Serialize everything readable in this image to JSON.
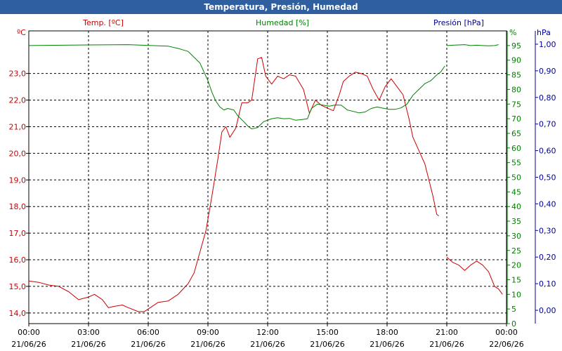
{
  "window": {
    "title": "Temperatura, Presión, Humedad"
  },
  "colors": {
    "temp": "#cc0000",
    "hum": "#008000",
    "pres": "#000099",
    "titlebar": "#2f5f9e"
  },
  "chart_data": {
    "type": "line",
    "title": "Temperatura, Presión, Humedad",
    "grid": true,
    "x_range": [
      "21/06/26 00:00",
      "22/06/26 00:00"
    ],
    "x_ticks": [
      {
        "time": "00:00",
        "date": "21/06/26"
      },
      {
        "time": "03:00",
        "date": "21/06/26"
      },
      {
        "time": "06:00",
        "date": "21/06/26"
      },
      {
        "time": "09:00",
        "date": "21/06/26"
      },
      {
        "time": "12:00",
        "date": "21/06/26"
      },
      {
        "time": "15:00",
        "date": "21/06/26"
      },
      {
        "time": "18:00",
        "date": "21/06/26"
      },
      {
        "time": "21:00",
        "date": "21/06/26"
      },
      {
        "time": "00:00",
        "date": "22/06/26"
      }
    ],
    "axes": {
      "temp": {
        "label": "Temp. [ºC]",
        "unit": "ºC",
        "range": [
          13.6,
          24.6
        ],
        "ticks": [
          "14,0",
          "15,0",
          "16,0",
          "17,0",
          "18,0",
          "19,0",
          "20,0",
          "21,0",
          "22,0",
          "23,0"
        ]
      },
      "hum": {
        "label": "Humedad [%]",
        "unit": "%",
        "range": [
          0,
          100
        ],
        "ticks": [
          "0",
          "5",
          "10",
          "15",
          "20",
          "25",
          "30",
          "35",
          "40",
          "45",
          "50",
          "55",
          "60",
          "65",
          "70",
          "75",
          "80",
          "85",
          "90",
          "95"
        ]
      },
      "pres": {
        "label": "Presión [hPa]",
        "unit": "hPa",
        "range": [
          -0.05,
          1.05
        ],
        "ticks": [
          "0,00",
          "0,10",
          "0,20",
          "0,30",
          "0,40",
          "0,50",
          "0,60",
          "0,70",
          "0,80",
          "0,90",
          "1,00"
        ]
      }
    },
    "series": [
      {
        "name": "Temp. [ºC]",
        "axis": "temp",
        "color": "#cc0000",
        "segments": [
          [
            [
              0,
              15.2
            ],
            [
              0.5,
              15.15
            ],
            [
              1,
              15.05
            ],
            [
              1.5,
              15.0
            ],
            [
              2,
              14.8
            ],
            [
              2.5,
              14.5
            ],
            [
              3,
              14.6
            ],
            [
              3.3,
              14.7
            ],
            [
              3.7,
              14.5
            ],
            [
              4,
              14.2
            ],
            [
              4.3,
              14.25
            ],
            [
              4.7,
              14.3
            ],
            [
              5,
              14.2
            ],
            [
              5.5,
              14.05
            ],
            [
              5.8,
              14.05
            ],
            [
              6.1,
              14.2
            ],
            [
              6.5,
              14.4
            ],
            [
              7,
              14.45
            ],
            [
              7.5,
              14.7
            ],
            [
              8,
              15.1
            ],
            [
              8.3,
              15.5
            ],
            [
              8.6,
              16.3
            ],
            [
              8.9,
              17.1
            ],
            [
              9.2,
              18.4
            ],
            [
              9.5,
              19.8
            ],
            [
              9.7,
              20.8
            ],
            [
              9.9,
              21.0
            ],
            [
              10.1,
              20.6
            ],
            [
              10.4,
              20.95
            ],
            [
              10.7,
              21.9
            ],
            [
              11.0,
              21.9
            ],
            [
              11.2,
              22.0
            ],
            [
              11.5,
              23.55
            ],
            [
              11.7,
              23.6
            ],
            [
              11.9,
              22.9
            ],
            [
              12.2,
              22.6
            ],
            [
              12.5,
              22.9
            ],
            [
              12.8,
              22.8
            ],
            [
              13.1,
              22.95
            ],
            [
              13.4,
              22.9
            ],
            [
              13.8,
              22.4
            ],
            [
              14.1,
              21.5
            ],
            [
              14.4,
              22.0
            ],
            [
              14.7,
              21.8
            ],
            [
              15.0,
              21.7
            ],
            [
              15.3,
              21.6
            ],
            [
              15.6,
              22.2
            ],
            [
              15.8,
              22.7
            ],
            [
              16.1,
              22.9
            ],
            [
              16.4,
              23.05
            ],
            [
              16.7,
              23.0
            ],
            [
              17.0,
              22.9
            ],
            [
              17.3,
              22.4
            ],
            [
              17.6,
              22.0
            ],
            [
              17.9,
              22.5
            ],
            [
              18.2,
              22.8
            ],
            [
              18.5,
              22.5
            ],
            [
              18.8,
              22.2
            ],
            [
              19.1,
              21.3
            ],
            [
              19.3,
              20.6
            ],
            [
              19.6,
              20.1
            ],
            [
              19.9,
              19.6
            ],
            [
              20.1,
              19.0
            ],
            [
              20.3,
              18.4
            ],
            [
              20.5,
              17.7
            ],
            [
              20.6,
              17.65
            ]
          ],
          [
            [
              21.0,
              16.1
            ],
            [
              21.3,
              15.9
            ],
            [
              21.6,
              15.8
            ],
            [
              21.9,
              15.6
            ],
            [
              22.2,
              15.8
            ],
            [
              22.5,
              15.95
            ],
            [
              22.8,
              15.8
            ],
            [
              23.1,
              15.55
            ],
            [
              23.4,
              15.0
            ],
            [
              23.6,
              14.9
            ],
            [
              23.8,
              14.7
            ]
          ]
        ]
      },
      {
        "name": "Humedad [%]",
        "axis": "hum",
        "color": "#008000",
        "segments": [
          [
            [
              0,
              95.0
            ],
            [
              3,
              95.2
            ],
            [
              5,
              95.3
            ],
            [
              7,
              94.8
            ],
            [
              7.5,
              94.0
            ],
            [
              8,
              93.0
            ],
            [
              8.3,
              91.0
            ],
            [
              8.6,
              89.0
            ],
            [
              8.8,
              86.0
            ],
            [
              9.0,
              83.0
            ],
            [
              9.2,
              79.0
            ],
            [
              9.4,
              76.0
            ],
            [
              9.6,
              74.0
            ],
            [
              9.8,
              73.0
            ],
            [
              10.0,
              73.5
            ],
            [
              10.3,
              73.0
            ],
            [
              10.5,
              71.0
            ],
            [
              10.8,
              69.0
            ],
            [
              11.0,
              67.5
            ],
            [
              11.2,
              66.5
            ],
            [
              11.5,
              67.0
            ],
            [
              11.8,
              69.0
            ],
            [
              12.2,
              70.0
            ],
            [
              12.5,
              70.3
            ],
            [
              12.8,
              70.0
            ],
            [
              13.1,
              70.1
            ],
            [
              13.4,
              69.5
            ],
            [
              13.7,
              69.7
            ],
            [
              14.0,
              70.0
            ],
            [
              14.2,
              73.5
            ],
            [
              14.5,
              75.0
            ],
            [
              14.8,
              74.6
            ],
            [
              15.1,
              74.3
            ],
            [
              15.4,
              74.7
            ],
            [
              15.7,
              74.6
            ],
            [
              16.0,
              73.0
            ],
            [
              16.3,
              72.5
            ],
            [
              16.6,
              72.0
            ],
            [
              16.9,
              72.3
            ],
            [
              17.2,
              73.5
            ],
            [
              17.5,
              74.0
            ],
            [
              17.8,
              73.6
            ],
            [
              18.1,
              73.2
            ],
            [
              18.4,
              73.2
            ],
            [
              18.7,
              73.7
            ],
            [
              19.0,
              75.0
            ],
            [
              19.3,
              78.0
            ],
            [
              19.6,
              80.0
            ],
            [
              19.9,
              82.0
            ],
            [
              20.2,
              83.0
            ],
            [
              20.5,
              85.0
            ],
            [
              20.7,
              86.0
            ],
            [
              20.9,
              88.0
            ]
          ],
          [
            [
              21.0,
              95.0
            ],
            [
              21.3,
              95.1
            ],
            [
              21.6,
              95.2
            ],
            [
              21.9,
              95.3
            ],
            [
              22.2,
              95.0
            ],
            [
              22.5,
              95.1
            ],
            [
              22.8,
              95.0
            ],
            [
              23.1,
              94.9
            ],
            [
              23.4,
              95.0
            ],
            [
              23.6,
              95.3
            ]
          ]
        ]
      }
    ]
  }
}
